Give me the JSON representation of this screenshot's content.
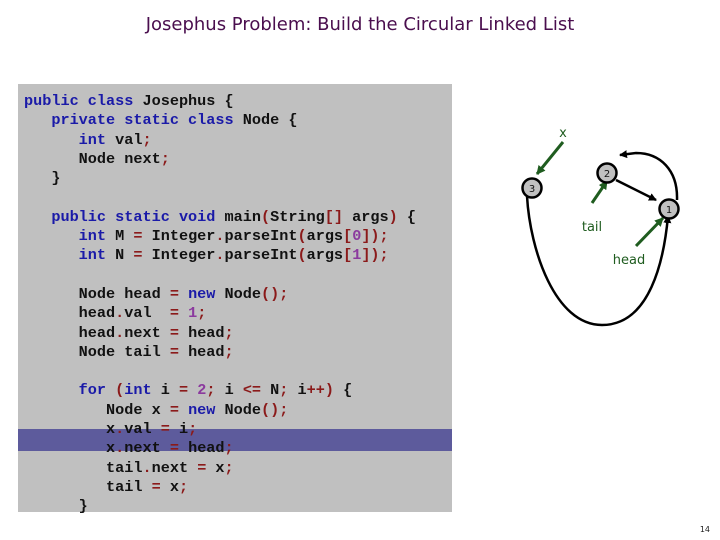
{
  "slide": {
    "title": "Josephus Problem:  Build the Circular Linked List",
    "page_number": "14"
  },
  "code": {
    "highlighted_line_index": 18,
    "lines": [
      [
        {
          "t": "public class ",
          "c": "kw"
        },
        {
          "t": "Josephus {",
          "c": ""
        }
      ],
      [
        {
          "t": "   private static class ",
          "c": "kw"
        },
        {
          "t": "Node {",
          "c": ""
        }
      ],
      [
        {
          "t": "      int ",
          "c": "kw"
        },
        {
          "t": "val",
          "c": ""
        },
        {
          "t": ";",
          "c": "op"
        }
      ],
      [
        {
          "t": "      Node next",
          "c": ""
        },
        {
          "t": ";",
          "c": "op"
        }
      ],
      [
        {
          "t": "   }",
          "c": ""
        }
      ],
      [
        {
          "t": "",
          "c": ""
        }
      ],
      [
        {
          "t": "   public static void ",
          "c": "kw"
        },
        {
          "t": "main",
          "c": ""
        },
        {
          "t": "(",
          "c": "op"
        },
        {
          "t": "String",
          "c": ""
        },
        {
          "t": "[]",
          "c": "op"
        },
        {
          "t": " args",
          "c": ""
        },
        {
          "t": ")",
          "c": "op"
        },
        {
          "t": " {",
          "c": ""
        }
      ],
      [
        {
          "t": "      int ",
          "c": "kw"
        },
        {
          "t": "M ",
          "c": ""
        },
        {
          "t": "=",
          "c": "op"
        },
        {
          "t": " Integer",
          "c": ""
        },
        {
          "t": ".",
          "c": "op"
        },
        {
          "t": "parseInt",
          "c": ""
        },
        {
          "t": "(",
          "c": "op"
        },
        {
          "t": "args",
          "c": ""
        },
        {
          "t": "[",
          "c": "op"
        },
        {
          "t": "0",
          "c": "num"
        },
        {
          "t": "]);",
          "c": "op"
        }
      ],
      [
        {
          "t": "      int ",
          "c": "kw"
        },
        {
          "t": "N ",
          "c": ""
        },
        {
          "t": "=",
          "c": "op"
        },
        {
          "t": " Integer",
          "c": ""
        },
        {
          "t": ".",
          "c": "op"
        },
        {
          "t": "parseInt",
          "c": ""
        },
        {
          "t": "(",
          "c": "op"
        },
        {
          "t": "args",
          "c": ""
        },
        {
          "t": "[",
          "c": "op"
        },
        {
          "t": "1",
          "c": "num"
        },
        {
          "t": "]);",
          "c": "op"
        }
      ],
      [
        {
          "t": "",
          "c": ""
        }
      ],
      [
        {
          "t": "      Node head ",
          "c": ""
        },
        {
          "t": "=",
          "c": "op"
        },
        {
          "t": " new ",
          "c": "kw"
        },
        {
          "t": "Node",
          "c": ""
        },
        {
          "t": "();",
          "c": "op"
        }
      ],
      [
        {
          "t": "      head",
          "c": ""
        },
        {
          "t": ".",
          "c": "op"
        },
        {
          "t": "val  ",
          "c": ""
        },
        {
          "t": "=",
          "c": "op"
        },
        {
          "t": " ",
          "c": ""
        },
        {
          "t": "1",
          "c": "num"
        },
        {
          "t": ";",
          "c": "op"
        }
      ],
      [
        {
          "t": "      head",
          "c": ""
        },
        {
          "t": ".",
          "c": "op"
        },
        {
          "t": "next ",
          "c": ""
        },
        {
          "t": "=",
          "c": "op"
        },
        {
          "t": " head",
          "c": ""
        },
        {
          "t": ";",
          "c": "op"
        }
      ],
      [
        {
          "t": "      Node tail ",
          "c": ""
        },
        {
          "t": "=",
          "c": "op"
        },
        {
          "t": " head",
          "c": ""
        },
        {
          "t": ";",
          "c": "op"
        }
      ],
      [
        {
          "t": "",
          "c": ""
        }
      ],
      [
        {
          "t": "      for ",
          "c": "kw"
        },
        {
          "t": "(",
          "c": "op"
        },
        {
          "t": "int ",
          "c": "kw"
        },
        {
          "t": "i ",
          "c": ""
        },
        {
          "t": "=",
          "c": "op"
        },
        {
          "t": " ",
          "c": ""
        },
        {
          "t": "2",
          "c": "num"
        },
        {
          "t": ";",
          "c": "op"
        },
        {
          "t": " i ",
          "c": ""
        },
        {
          "t": "<=",
          "c": "op"
        },
        {
          "t": " N",
          "c": ""
        },
        {
          "t": ";",
          "c": "op"
        },
        {
          "t": " i",
          "c": ""
        },
        {
          "t": "++)",
          "c": "op"
        },
        {
          "t": " {",
          "c": ""
        }
      ],
      [
        {
          "t": "         Node x ",
          "c": ""
        },
        {
          "t": "=",
          "c": "op"
        },
        {
          "t": " new ",
          "c": "kw"
        },
        {
          "t": "Node",
          "c": ""
        },
        {
          "t": "();",
          "c": "op"
        }
      ],
      [
        {
          "t": "         x",
          "c": ""
        },
        {
          "t": ".",
          "c": "op"
        },
        {
          "t": "val ",
          "c": ""
        },
        {
          "t": "=",
          "c": "op"
        },
        {
          "t": " i",
          "c": ""
        },
        {
          "t": ";",
          "c": "op"
        }
      ],
      [
        {
          "t": "         x",
          "c": ""
        },
        {
          "t": ".",
          "c": "op"
        },
        {
          "t": "next ",
          "c": ""
        },
        {
          "t": "=",
          "c": "op"
        },
        {
          "t": " head",
          "c": ""
        },
        {
          "t": ";",
          "c": "op"
        }
      ],
      [
        {
          "t": "         tail",
          "c": ""
        },
        {
          "t": ".",
          "c": "op"
        },
        {
          "t": "next ",
          "c": ""
        },
        {
          "t": "=",
          "c": "op"
        },
        {
          "t": " x",
          "c": ""
        },
        {
          "t": ";",
          "c": "op"
        }
      ],
      [
        {
          "t": "         tail ",
          "c": ""
        },
        {
          "t": "=",
          "c": "op"
        },
        {
          "t": " x",
          "c": ""
        },
        {
          "t": ";",
          "c": "op"
        }
      ],
      [
        {
          "t": "      }",
          "c": ""
        }
      ]
    ]
  },
  "diagram": {
    "nodes": [
      {
        "id": "node-1",
        "label": "1"
      },
      {
        "id": "node-2",
        "label": "2"
      },
      {
        "id": "node-3",
        "label": "3"
      }
    ],
    "pointers": [
      {
        "label": "x",
        "target": "3"
      },
      {
        "label": "tail",
        "target": "2"
      },
      {
        "label": "head",
        "target": "1"
      }
    ],
    "colors": {
      "pointer": "#1f5c1f",
      "node_fill": "#c0c0c0",
      "edge": "#000000",
      "highlight": "#5d5b9c",
      "title": "#4a0e4e"
    }
  }
}
